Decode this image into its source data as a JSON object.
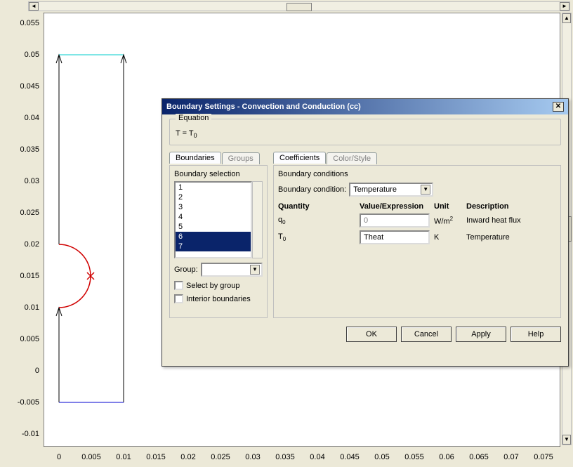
{
  "chart_data": {
    "type": "diagram",
    "xticks": [
      "0",
      "0.005",
      "0.01",
      "0.015",
      "0.02",
      "0.025",
      "0.03",
      "0.035",
      "0.04",
      "0.045",
      "0.05",
      "0.055",
      "0.06",
      "0.065",
      "0.07",
      "0.075"
    ],
    "yticks": [
      "-0.01",
      "-0.005",
      "0",
      "0.005",
      "0.01",
      "0.015",
      "0.02",
      "0.025",
      "0.03",
      "0.035",
      "0.04",
      "0.045",
      "0.05",
      "0.055"
    ],
    "xrange": [
      -0.0025,
      0.0775
    ],
    "yrange": [
      -0.0125,
      0.0575
    ]
  },
  "dialog": {
    "title": "Boundary Settings - Convection and Conduction (cc)",
    "equation_label": "Equation",
    "equation_text_pre": "T = T",
    "equation_text_sub": "0",
    "tabs_left": {
      "boundaries": "Boundaries",
      "groups": "Groups"
    },
    "tabs_right": {
      "coefficients": "Coefficients",
      "colorstyle": "Color/Style"
    },
    "boundary_selection_label": "Boundary selection",
    "boundary_list": [
      "1",
      "2",
      "3",
      "4",
      "5",
      "6",
      "7"
    ],
    "selected_boundaries": [
      "6",
      "7"
    ],
    "group_label": "Group:",
    "group_value": "",
    "select_by_group_label": "Select by group",
    "interior_boundaries_label": "Interior boundaries",
    "boundary_conditions_label": "Boundary conditions",
    "boundary_condition_label": "Boundary condition:",
    "boundary_condition_value": "Temperature",
    "headers": {
      "quantity": "Quantity",
      "value": "Value/Expression",
      "unit": "Unit",
      "description": "Description"
    },
    "rows": [
      {
        "qty_base": "q",
        "qty_sub": "0",
        "value": "0",
        "unit_html": "W/m²",
        "desc": "Inward heat flux",
        "disabled": true
      },
      {
        "qty_base": "T",
        "qty_sub": "0",
        "value": "Theat",
        "unit_html": "K",
        "desc": "Temperature",
        "disabled": false
      }
    ],
    "buttons": {
      "ok": "OK",
      "cancel": "Cancel",
      "apply": "Apply",
      "help": "Help"
    }
  }
}
